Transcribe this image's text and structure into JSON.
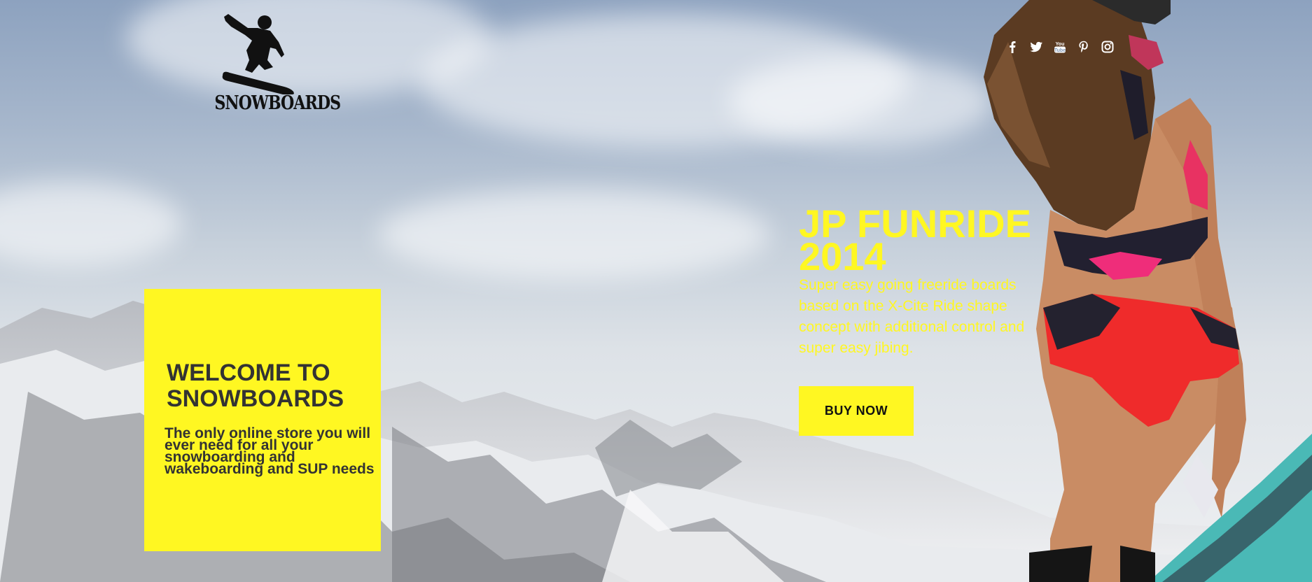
{
  "brand": {
    "logo_text": "SNOWBOARDS"
  },
  "social": [
    {
      "icon": "facebook-icon"
    },
    {
      "icon": "twitter-icon"
    },
    {
      "icon": "youtube-icon"
    },
    {
      "icon": "pinterest-icon"
    },
    {
      "icon": "instagram-icon"
    }
  ],
  "welcome": {
    "title": "WELCOME TO SNOWBOARDS",
    "text": "The only online store you will ever need for all your snowboarding and wakeboarding and SUP needs"
  },
  "promo": {
    "title": "JP FUNRIDE 2014",
    "text": "Super easy going freeride boards based on the X-Cite Ride shape concept with additional control and super easy jibing.",
    "button_label": "BUY NOW"
  },
  "colors": {
    "accent": "#fff722",
    "dark_text": "#333333"
  }
}
